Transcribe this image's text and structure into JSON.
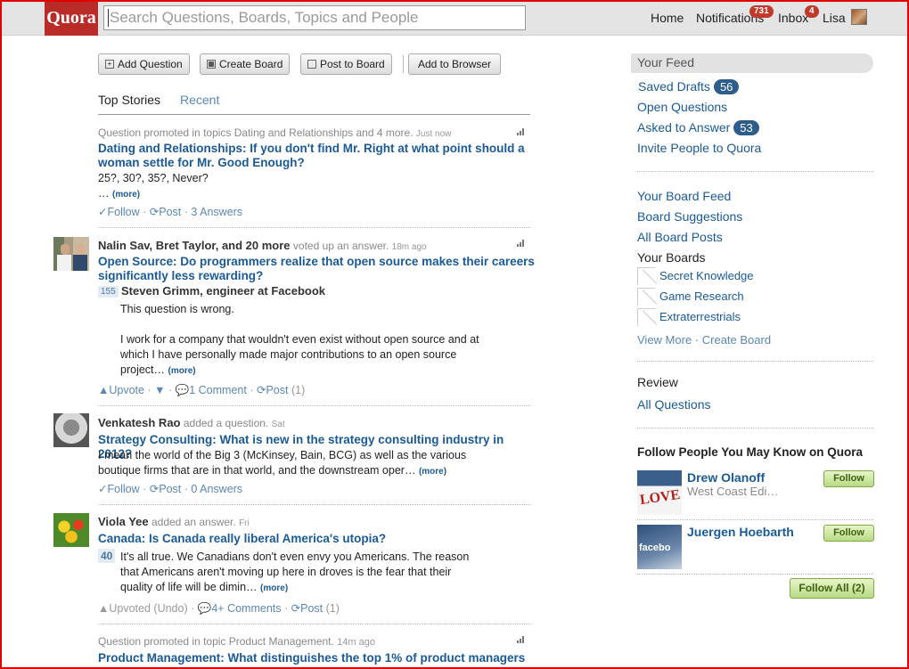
{
  "header": {
    "logo": "Quora",
    "search_placeholder": "Search Questions, Boards, Topics and People",
    "nav": {
      "home": "Home",
      "notifications": "Notifications",
      "notifications_count": "731",
      "inbox": "Inbox",
      "inbox_count": "4",
      "user": "Lisa"
    }
  },
  "toolbar": {
    "add_question": "Add Question",
    "create_board": "Create Board",
    "post_to_board": "Post to Board",
    "add_to_browser": "Add to Browser"
  },
  "tabs": {
    "top_stories": "Top Stories",
    "recent": "Recent"
  },
  "stories": [
    {
      "meta": "Question promoted in topics Dating and Relationships and 4 more.",
      "time": "Just now",
      "title_line1": "Dating and Relationships: If you don't find Mr. Right at what point should a",
      "title_line2": "woman settle for Mr. Good Enough?",
      "body_line1": "25?, 30?, 35?, Never?",
      "ellipsis": "…",
      "more": "(more)",
      "follow": "Follow",
      "post": "Post",
      "answers": "3 Answers"
    },
    {
      "actors": "Nalin Sav, Bret Taylor, and 20 more",
      "action": "voted up an answer.",
      "time": "18m ago",
      "title_line1": "Open Source: Do programmers realize that open source makes their careers",
      "title_line2": "significantly less rewarding?",
      "votes": "155",
      "author": "Steven Grimm, engineer at Facebook",
      "body_line1": "This question is wrong.",
      "body_line2": "I work for a company that wouldn't even exist without open source and at",
      "body_line3": "which I have personally made major contributions to an open source",
      "body_line4": "project…",
      "more": "(more)",
      "upvote": "Upvote",
      "comment": "1 Comment",
      "post": "Post",
      "post_count": "(1)"
    },
    {
      "actor": "Venkatesh Rao",
      "action": "added a question.",
      "time": "Sat",
      "title": "Strategy Consulting: What is new in the strategy consulting industry in 2012?",
      "body_line1": "I mean the world of the Big 3 (McKinsey, Bain, BCG) as well as the various",
      "body_line2": "boutique firms that are in that world, and the downstream oper…",
      "more": "(more)",
      "follow": "Follow",
      "post": "Post",
      "answers": "0 Answers"
    },
    {
      "actor": "Viola Yee",
      "action": "added an answer.",
      "time": "Fri",
      "title": "Canada: Is Canada really liberal America's utopia?",
      "votes": "40",
      "body_line1": "It's all true.  We Canadians don't even envy you Americans.  The reason",
      "body_line2": "that Americans aren't moving up here in droves is the fear that their",
      "body_line3": "quality of life  will be dimin…",
      "more": "(more)",
      "upvoted": "Upvoted (Undo)",
      "comments": "4+ Comments",
      "post": "Post",
      "post_count": "(1)"
    },
    {
      "meta": "Question promoted in topic Product Management.",
      "time": "14m ago",
      "title_line1": "Product Management: What distinguishes the top 1% of product managers"
    }
  ],
  "sidebar": {
    "your_feed": "Your Feed",
    "saved_drafts": "Saved Drafts",
    "saved_drafts_count": "56",
    "open_questions": "Open Questions",
    "asked_to_answer": "Asked to Answer",
    "asked_to_answer_count": "53",
    "invite": "Invite People to Quora",
    "board_feed": "Your Board Feed",
    "board_suggestions": "Board Suggestions",
    "all_board_posts": "All Board Posts",
    "your_boards": "Your Boards",
    "boards": [
      "Secret Knowledge",
      "Game Research",
      "Extraterrestrials"
    ],
    "view_more": "View More",
    "create_board": "Create Board",
    "review": "Review",
    "all_questions": "All Questions",
    "follow_people": "Follow People You May Know on Quora",
    "people": [
      {
        "name": "Drew Olanoff",
        "sub": "West Coast Edi…",
        "button": "Follow"
      },
      {
        "name": "Juergen Hoebarth",
        "sub": "",
        "button": "Follow"
      }
    ],
    "follow_all": "Follow All (2)"
  }
}
